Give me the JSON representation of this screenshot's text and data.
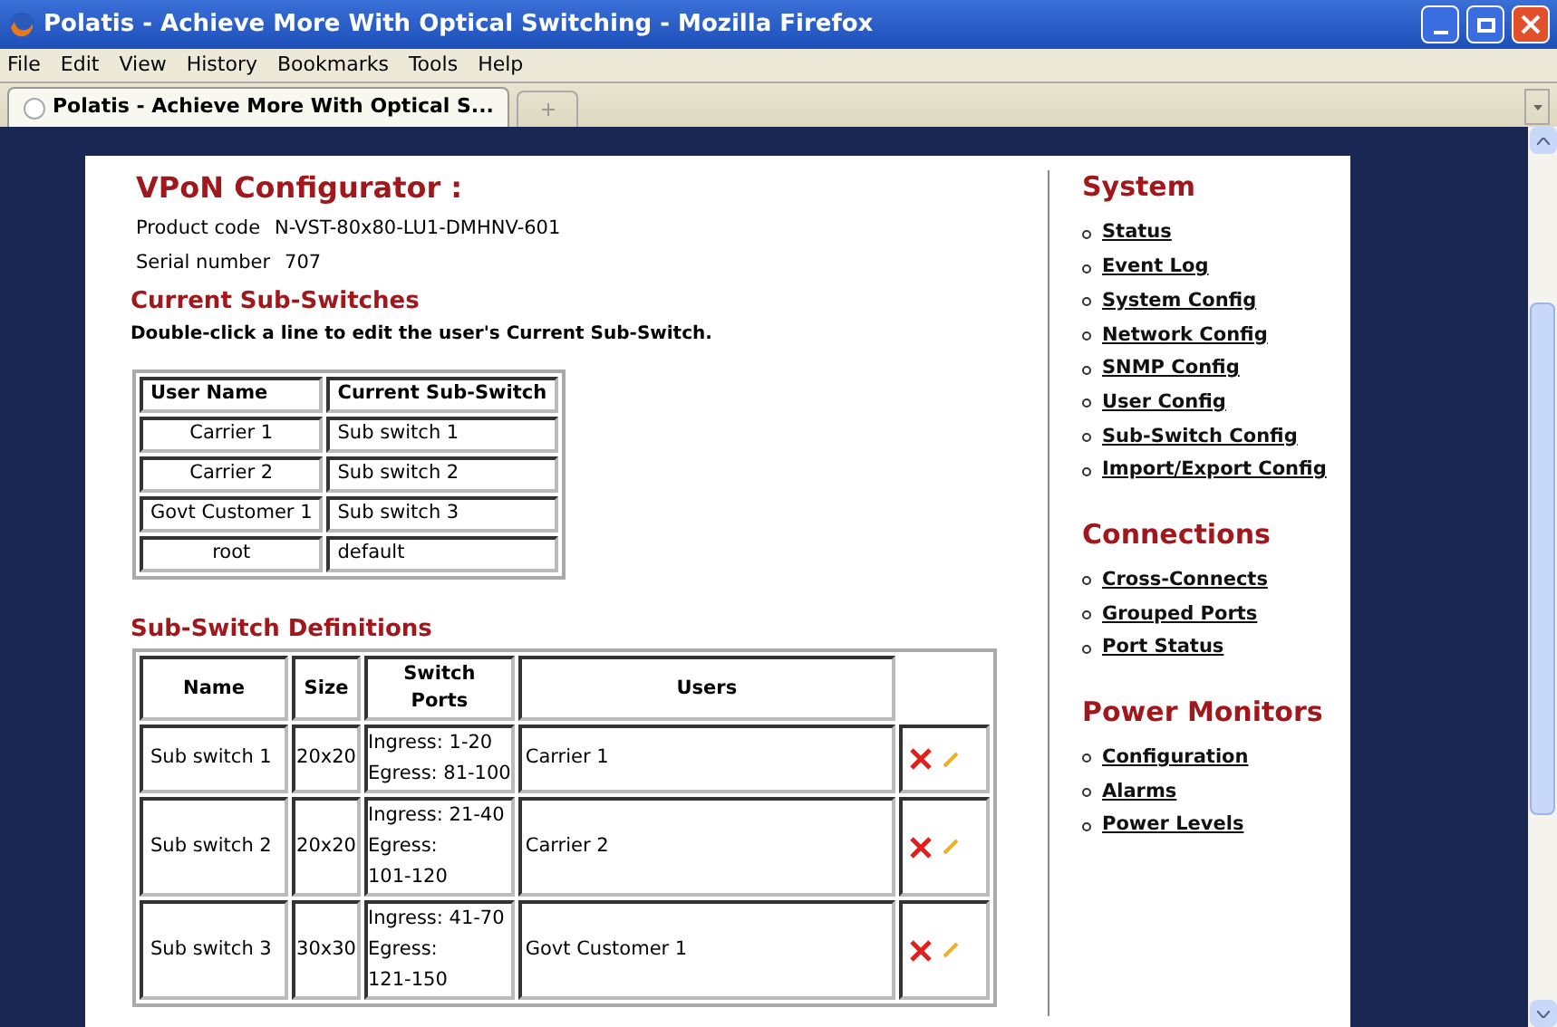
{
  "window": {
    "title": "Polatis - Achieve More With Optical Switching - Mozilla Firefox"
  },
  "menu": [
    "File",
    "Edit",
    "View",
    "History",
    "Bookmarks",
    "Tools",
    "Help"
  ],
  "tabs": [
    {
      "label": "Polatis - Achieve More With Optical S...",
      "selected": true
    }
  ],
  "page": {
    "title": "VPoN Configurator :",
    "info": [
      {
        "label": "Product code",
        "value": "N-VST-80x80-LU1-DMHNV-601"
      },
      {
        "label": "Serial number",
        "value": "707"
      }
    ],
    "current": {
      "heading": "Current Sub-Switches",
      "hint": "Double-click a line to edit the user's Current Sub-Switch.",
      "columns": [
        "User Name",
        "Current Sub-Switch"
      ],
      "rows": [
        [
          "Carrier 1",
          "Sub switch 1"
        ],
        [
          "Carrier 2",
          "Sub switch 2"
        ],
        [
          "Govt Customer 1",
          "Sub switch 3"
        ],
        [
          "root",
          "default"
        ]
      ]
    },
    "definitions": {
      "heading": "Sub-Switch Definitions",
      "columns": [
        "Name",
        "Size",
        "Switch Ports",
        "Users"
      ],
      "rows": [
        {
          "name": "Sub switch 1",
          "size": "20x20",
          "ports": [
            "Ingress: 1-20",
            "Egress: 81-100"
          ],
          "users": "Carrier 1"
        },
        {
          "name": "Sub switch 2",
          "size": "20x20",
          "ports": [
            "Ingress: 21-40",
            "Egress:",
            "101-120"
          ],
          "users": "Carrier 2"
        },
        {
          "name": "Sub switch 3",
          "size": "30x30",
          "ports": [
            "Ingress: 41-70",
            "Egress:",
            "121-150"
          ],
          "users": "Govt Customer 1"
        }
      ]
    }
  },
  "sidebar": [
    {
      "heading": "System",
      "items": [
        "Status",
        "Event Log",
        "System Config",
        "Network Config",
        "SNMP Config",
        "User Config",
        "Sub-Switch Config",
        "Import/Export Config"
      ]
    },
    {
      "heading": "Connections",
      "items": [
        "Cross-Connects",
        "Grouped Ports",
        "Port Status"
      ]
    },
    {
      "heading": "Power Monitors",
      "items": [
        "Configuration",
        "Alarms",
        "Power Levels"
      ]
    }
  ]
}
